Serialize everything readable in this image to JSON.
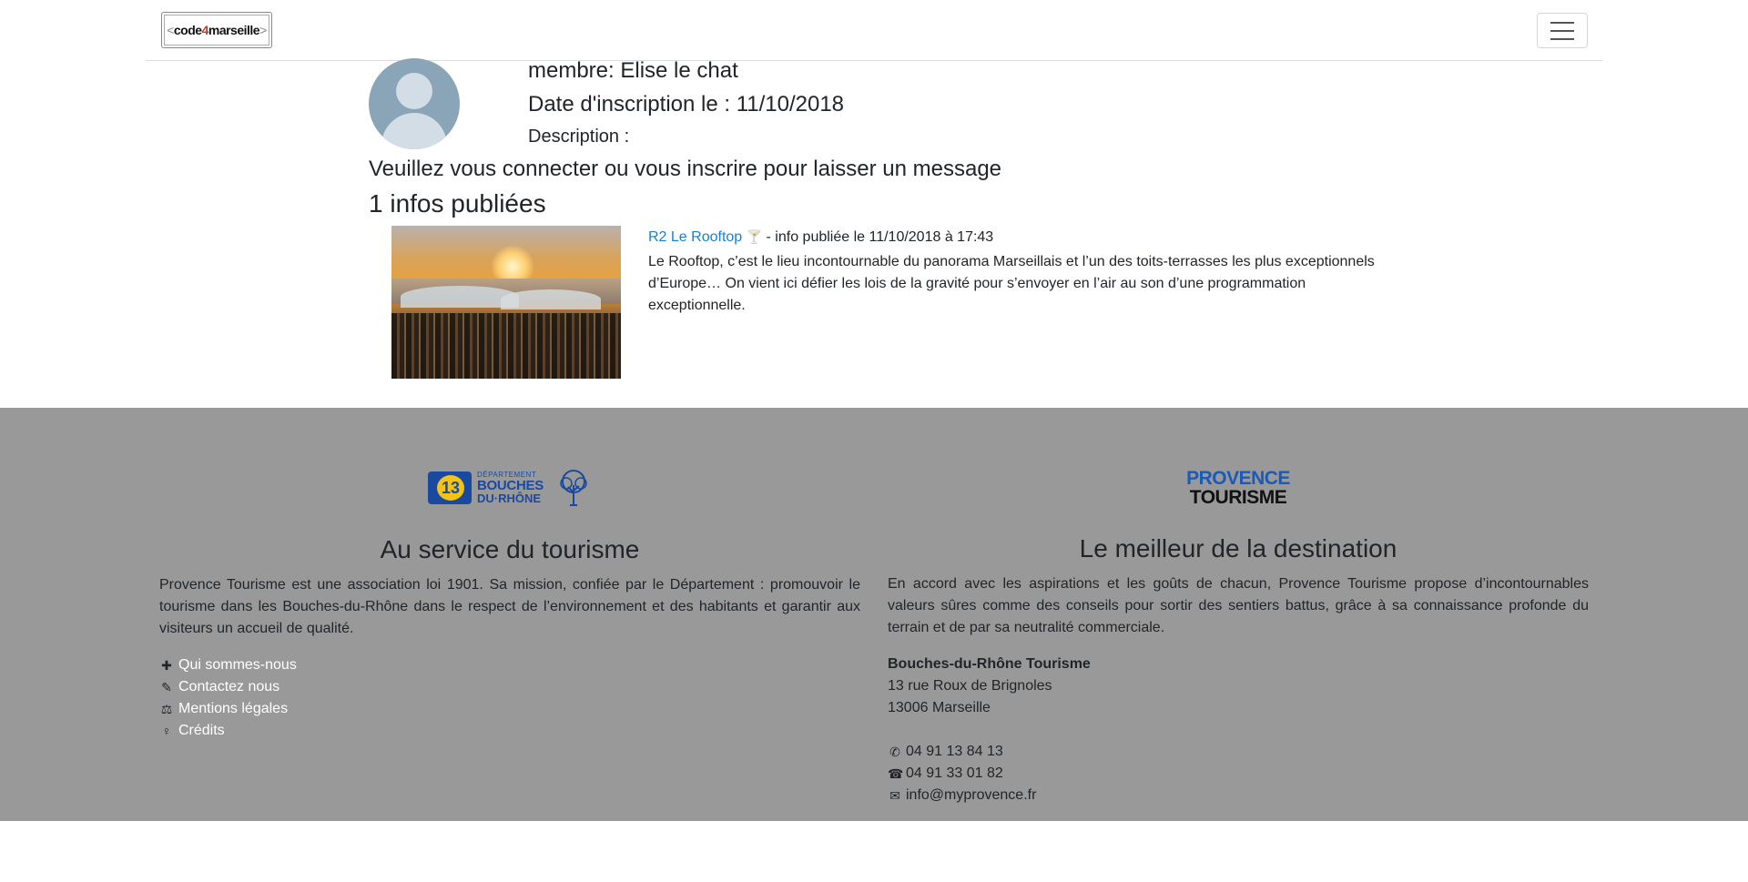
{
  "navbar": {
    "brand": {
      "lt": "<",
      "code": "code",
      "four": "4",
      "marseille": "marseille",
      "gt": ">"
    },
    "toggle_icon": "hamburger-icon"
  },
  "profile": {
    "avatar_icon": "user-avatar-icon",
    "member": "membre: Elise le chat",
    "date": "Date d'inscription le : 11/10/2018",
    "description_label": "Description :"
  },
  "login_message": "Veuillez vous connecter ou vous inscrire pour laisser un message",
  "infos_count_title": "1 infos publiées",
  "infos": [
    {
      "title": "R2 Le Rooftop",
      "icon": "cocktail-icon",
      "meta": " - info publiée le 11/10/2018 à 17:43",
      "text": "Le Rooftop, c’est le lieu incontournable du panorama Marseillais et l’un des toits-terrasses les plus exceptionnels d’Europe… On vient ici défier les lois de la gravité pour s’envoyer en l’air au son d’une programmation exceptionnelle."
    }
  ],
  "footer": {
    "bg_color": "#999999",
    "left": {
      "logo": {
        "small": "DÉPARTEMENT",
        "line1": "BOUCHES",
        "line2": "DU·RHÔNE",
        "number": "13"
      },
      "title": "Au service du tourisme",
      "text": "Provence Tourisme est une association loi 1901. Sa mission, confiée par le Département : promouvoir le tourisme dans les Bouches-du-Rhône dans le respect de l’environnement et des habitants et garantir aux visiteurs un accueil de qualité.",
      "links": [
        {
          "icon": "puzzle-icon",
          "label": "Qui sommes-nous"
        },
        {
          "icon": "pencil-icon",
          "label": "Contactez nous"
        },
        {
          "icon": "balance-scale-icon",
          "label": "Mentions légales"
        },
        {
          "icon": "award-icon",
          "label": "Crédits"
        }
      ]
    },
    "right": {
      "logo": {
        "line1": "PROVENCE",
        "line2": "TOURISME"
      },
      "title": "Le meilleur de la destination",
      "text": "En accord avec les aspirations et les goûts de chacun, Provence Tourisme propose d’incontournables valeurs sûres comme des conseils pour sortir des sentiers battus, grâce à sa connaissance profonde du terrain et de par sa neutralité commerciale.",
      "org": "Bouches-du-Rhône Tourisme",
      "address1": "13 rue Roux de Brignoles",
      "address2": "13006 Marseille",
      "phone": "04 91 13 84 13",
      "fax": "04 91 33 01 82",
      "email": "info@myprovence.fr"
    }
  }
}
